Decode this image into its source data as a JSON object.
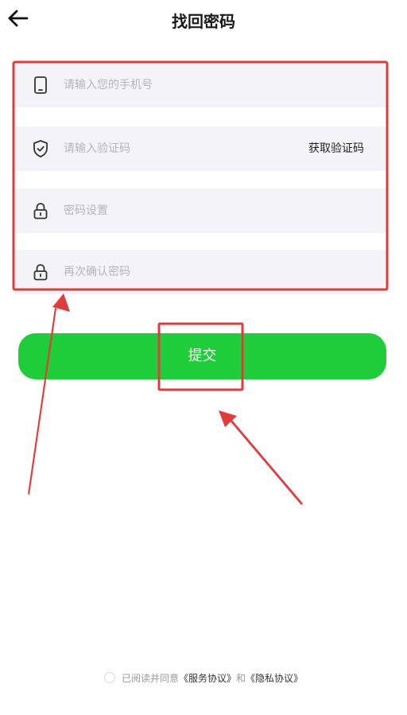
{
  "header": {
    "title": "找回密码",
    "back_icon": "arrow-left-icon"
  },
  "form": {
    "phone": {
      "placeholder": "请输入您的手机号",
      "icon": "mobile-phone-icon"
    },
    "code": {
      "placeholder": "请输入验证码",
      "icon": "shield-check-icon",
      "get_code_label": "获取验证码"
    },
    "password": {
      "placeholder": "密码设置",
      "icon": "lock-icon"
    },
    "confirm": {
      "placeholder": "再次确认密码",
      "icon": "lock-icon"
    }
  },
  "submit": {
    "label": "提交"
  },
  "agreement": {
    "prefix": "已阅读并同意",
    "service_link": "《服务协议》",
    "conjunction": "和",
    "privacy_link": "《隐私协议》"
  },
  "colors": {
    "primary_green": "#1fcd3a",
    "annotation_red": "#e23b3b",
    "field_bg": "#f4f4f8"
  }
}
